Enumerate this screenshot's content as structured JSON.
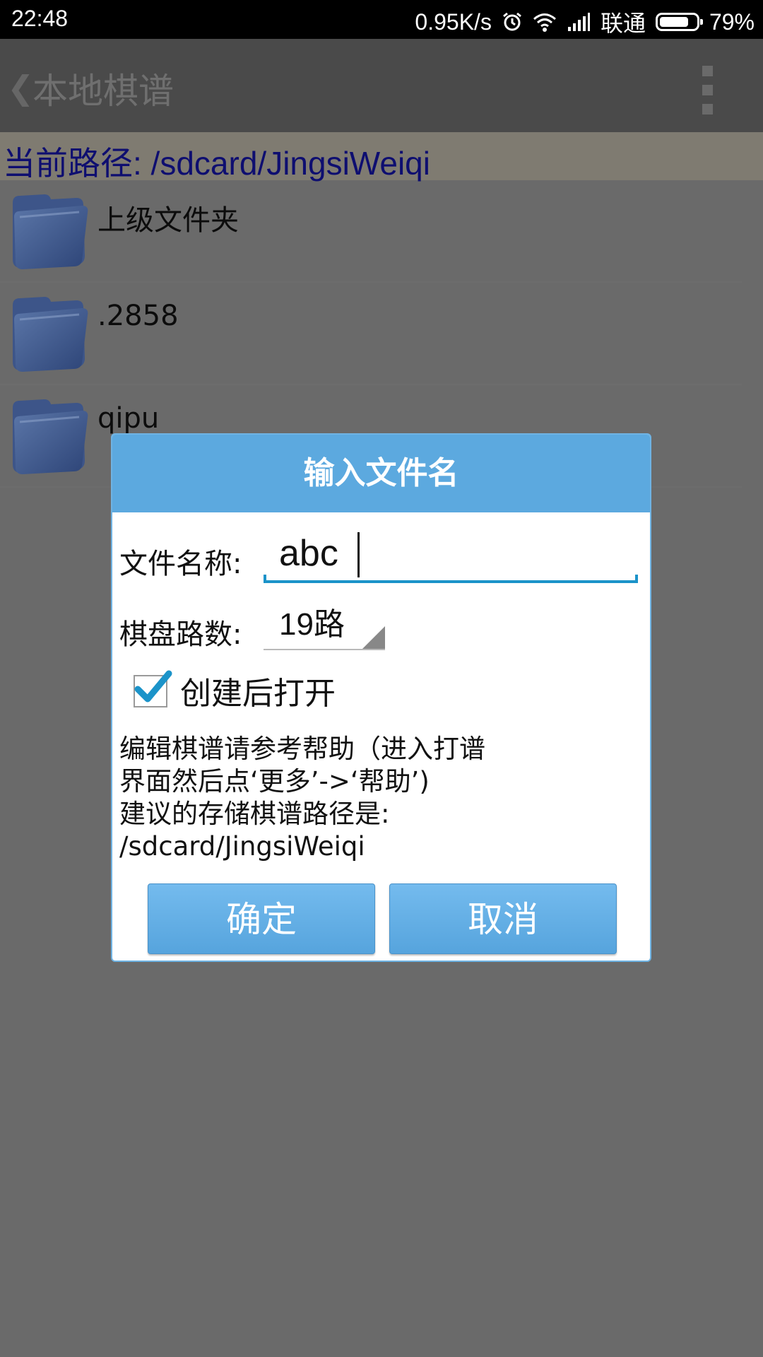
{
  "status_bar": {
    "time": "22:48",
    "net_speed": "0.95K/s",
    "carrier": "联通",
    "battery_percent": "79%",
    "battery_level": 0.79,
    "icons": [
      "alarm-icon",
      "wifi-icon",
      "signal-icon",
      "battery-icon"
    ]
  },
  "action_bar": {
    "back_glyph": "❮",
    "title": "本地棋谱"
  },
  "path_bar": {
    "text": "当前路径: /sdcard/JingsiWeiqi"
  },
  "file_list": [
    {
      "name": "上级文件夹",
      "icon": "folder-icon"
    },
    {
      "name": ".2858",
      "icon": "folder-icon"
    },
    {
      "name": "qipu",
      "icon": "folder-icon"
    }
  ],
  "dialog": {
    "title": "输入文件名",
    "filename_label": "文件名称:",
    "filename_value": "abc",
    "board_label": "棋盘路数:",
    "board_value": "19路",
    "open_after_create_label": "创建后打开",
    "open_after_create_checked": true,
    "help_text": "编辑棋谱请参考帮助（进入打谱\n界面然后点‘更多’->‘帮助’)\n建议的存储棋谱路径是:\n/sdcard/JingsiWeiqi",
    "ok_label": "确定",
    "cancel_label": "取消"
  },
  "colors": {
    "dialog_header": "#5ca9df",
    "input_underline": "#1b93c9",
    "path_text": "#0e0e70"
  }
}
